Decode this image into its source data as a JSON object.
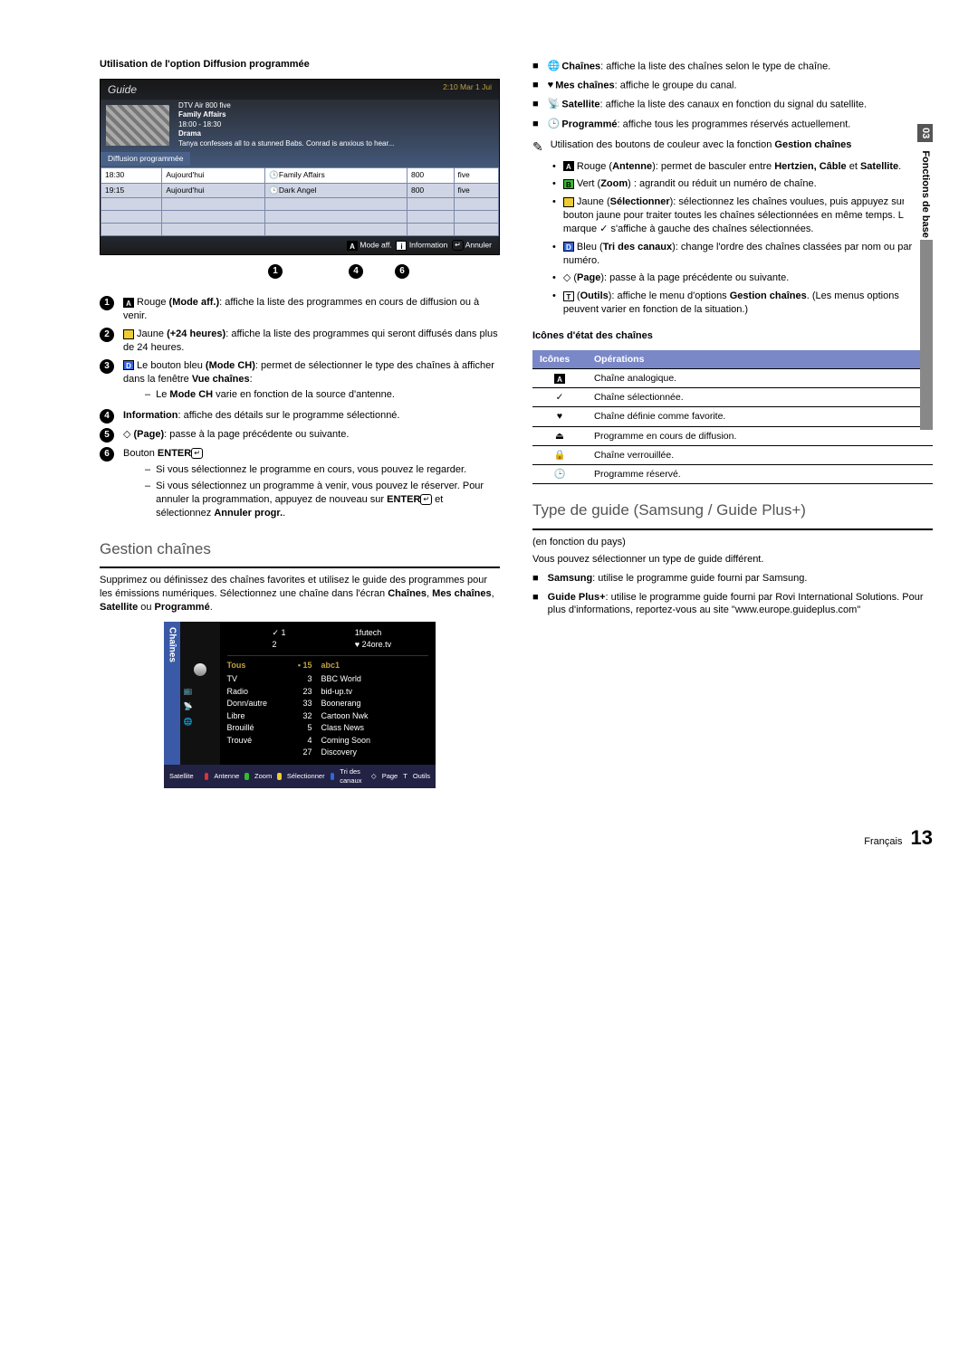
{
  "sidebar": {
    "section_num": "03",
    "section_title": "Fonctions de base"
  },
  "left": {
    "heading1": "Utilisation de l'option Diffusion programmée",
    "guide": {
      "title": "Guide",
      "clock": "2:10 Mar 1 Jui",
      "meta_line1": "DTV Air 800 five",
      "meta_line2": "Family Affairs",
      "meta_line3": "18:00 - 18:30",
      "meta_line4": "Drama",
      "meta_line5": "Tanya confesses all to a stunned Babs. Conrad is anxious to hear...",
      "ribbon": "Diffusion programmée",
      "rows": [
        {
          "t": "18:30",
          "d": "Aujourd'hui",
          "p": "Family Affairs",
          "n": "800",
          "c": "five"
        },
        {
          "t": "19:15",
          "d": "Aujourd'hui",
          "p": "Dark Angel",
          "n": "800",
          "c": "five"
        }
      ],
      "footer_mode": "Mode aff.",
      "footer_info": "Information",
      "footer_cancel": "Annuler"
    },
    "items": [
      {
        "n": "1",
        "glyph": "A",
        "pre": "Rouge",
        "bold": "(Mode aff.)",
        "post": ": affiche la liste des programmes en cours de diffusion ou à venir."
      },
      {
        "n": "2",
        "glyph": "■",
        "pre": "Jaune",
        "bold": "(+24 heures)",
        "post": ": affiche la liste des programmes qui seront diffusés dans plus de 24 heures."
      },
      {
        "n": "3",
        "glyph": "D",
        "pre": "Le bouton bleu",
        "bold": "(Mode CH)",
        "post": ": permet de sélectionner le type des chaînes à afficher dans la fenêtre Vue chaînes:",
        "sub": [
          "Le Mode CH varie en fonction de la source d'antenne."
        ]
      },
      {
        "n": "4",
        "plain_bold": "Information",
        "plain_post": ": affiche des détails sur le programme sélectionné."
      },
      {
        "n": "5",
        "sym": "◇",
        "bold": "(Page)",
        "post": ": passe à la page précédente ou suivante."
      },
      {
        "n": "6",
        "plain": "Bouton ",
        "plain_bold": "ENTER",
        "enter_icon": true,
        "sub": [
          "Si vous sélectionnez le programme en cours, vous pouvez le regarder.",
          "Si vous sélectionnez un programme à venir, vous pouvez le réserver. Pour annuler la programmation, appuyez de nouveau sur ENTER E et sélectionnez Annuler progr.."
        ]
      }
    ],
    "h2a": "Gestion chaînes",
    "gestion_intro": "Supprimez ou définissez des chaînes favorites et utilisez le guide des programmes pour les émissions numériques. Sélectionnez une chaîne dans l'écran Chaînes, Mes chaînes, Satellite ou Programmé.",
    "chscreen": {
      "tab": "Chaînes",
      "top": {
        "c1": [
          "✓ 1",
          "2"
        ],
        "c2": [
          "1futech",
          "♥ 24ore.tv"
        ]
      },
      "hdr_cat": "Tous",
      "hdr_num": "15",
      "hdr_name": "abc1",
      "cats": [
        "TV",
        "Radio",
        "Donn/autre",
        "Libre",
        "Brouillé",
        "Trouvé"
      ],
      "nums": [
        "3",
        "23",
        "33",
        "32",
        "5",
        "4",
        "27"
      ],
      "names": [
        "BBC World",
        "bid-up.tv",
        "Boonerang",
        "Cartoon Nwk",
        "Class News",
        "Coming Soon",
        "Discovery"
      ],
      "footer_src": "Satellite",
      "footer_items": [
        "Antenne",
        "Zoom",
        "Sélectionner",
        "Tri des canaux",
        "Page",
        "Outils"
      ]
    }
  },
  "right": {
    "sq": [
      {
        "bold": "Chaînes",
        "post": ": affiche la liste des chaînes selon le type de chaîne."
      },
      {
        "bold": "Mes chaînes",
        "post": ": affiche le groupe du canal."
      },
      {
        "bold": "Satellite",
        "post": ": affiche la liste des canaux en fonction du signal du satellite."
      },
      {
        "bold": "Programmé",
        "post": ": affiche tous les programmes réservés actuellement."
      }
    ],
    "note_pre": "Utilisation des boutons de couleur avec la fonction ",
    "note_bold": "Gestion chaînes",
    "dots": [
      {
        "color": "A",
        "pre": "Rouge (",
        "bold": "Antenne",
        "post": "): permet de basculer entre Hertzien, Câble et Satellite."
      },
      {
        "color": "B",
        "pre": "Vert (",
        "bold": "Zoom",
        "post": ") : agrandit ou réduit un numéro de chaîne."
      },
      {
        "color": "C",
        "pre": "Jaune (",
        "bold": "Sélectionner",
        "post": "): sélectionnez les chaînes voulues, puis appuyez sur le bouton jaune pour traiter toutes les chaînes sélectionnées en même temps. La marque ✓ s'affiche à gauche des chaînes sélectionnées."
      },
      {
        "color": "D",
        "pre": "Bleu (",
        "bold": "Tri des canaux",
        "post": "): change l'ordre des chaînes classées par nom ou par numéro."
      },
      {
        "sym": "◇",
        "pre": "(",
        "bold": "Page",
        "post": "): passe à la page précédente ou suivante."
      },
      {
        "sym": "T",
        "pre": "(",
        "bold": "Outils",
        "post": "): affiche le menu d'options Gestion chaînes. (Les menus options peuvent varier en fonction de la situation.)"
      }
    ],
    "icons_heading": "Icônes d'état des chaînes",
    "table_h1": "Icônes",
    "table_h2": "Opérations",
    "table_rows": [
      {
        "ic": "A",
        "op": "Chaîne analogique."
      },
      {
        "ic": "✓",
        "op": "Chaîne sélectionnée."
      },
      {
        "ic": "♥",
        "op": "Chaîne définie comme favorite."
      },
      {
        "ic": "⏏",
        "op": "Programme en cours de diffusion."
      },
      {
        "ic": "🔒",
        "op": "Chaîne verrouillée."
      },
      {
        "ic": "🕒",
        "op": "Programme réservé."
      }
    ],
    "h2b": "Type de guide (Samsung / Guide Plus+)",
    "subnote": "(en fonction du pays)",
    "subpara": "Vous pouvez sélectionner un type de guide différent.",
    "sq2": [
      {
        "bold": "Samsung",
        "post": ": utilise  le programme guide fourni par Samsung."
      },
      {
        "bold": "Guide Plus+",
        "post": ": utilise le programme guide fourni par Rovi International Solutions. Pour plus d'informations, reportez-vous au site \"www.europe.guideplus.com\""
      }
    ]
  },
  "footer": {
    "lang": "Français",
    "page": "13"
  }
}
